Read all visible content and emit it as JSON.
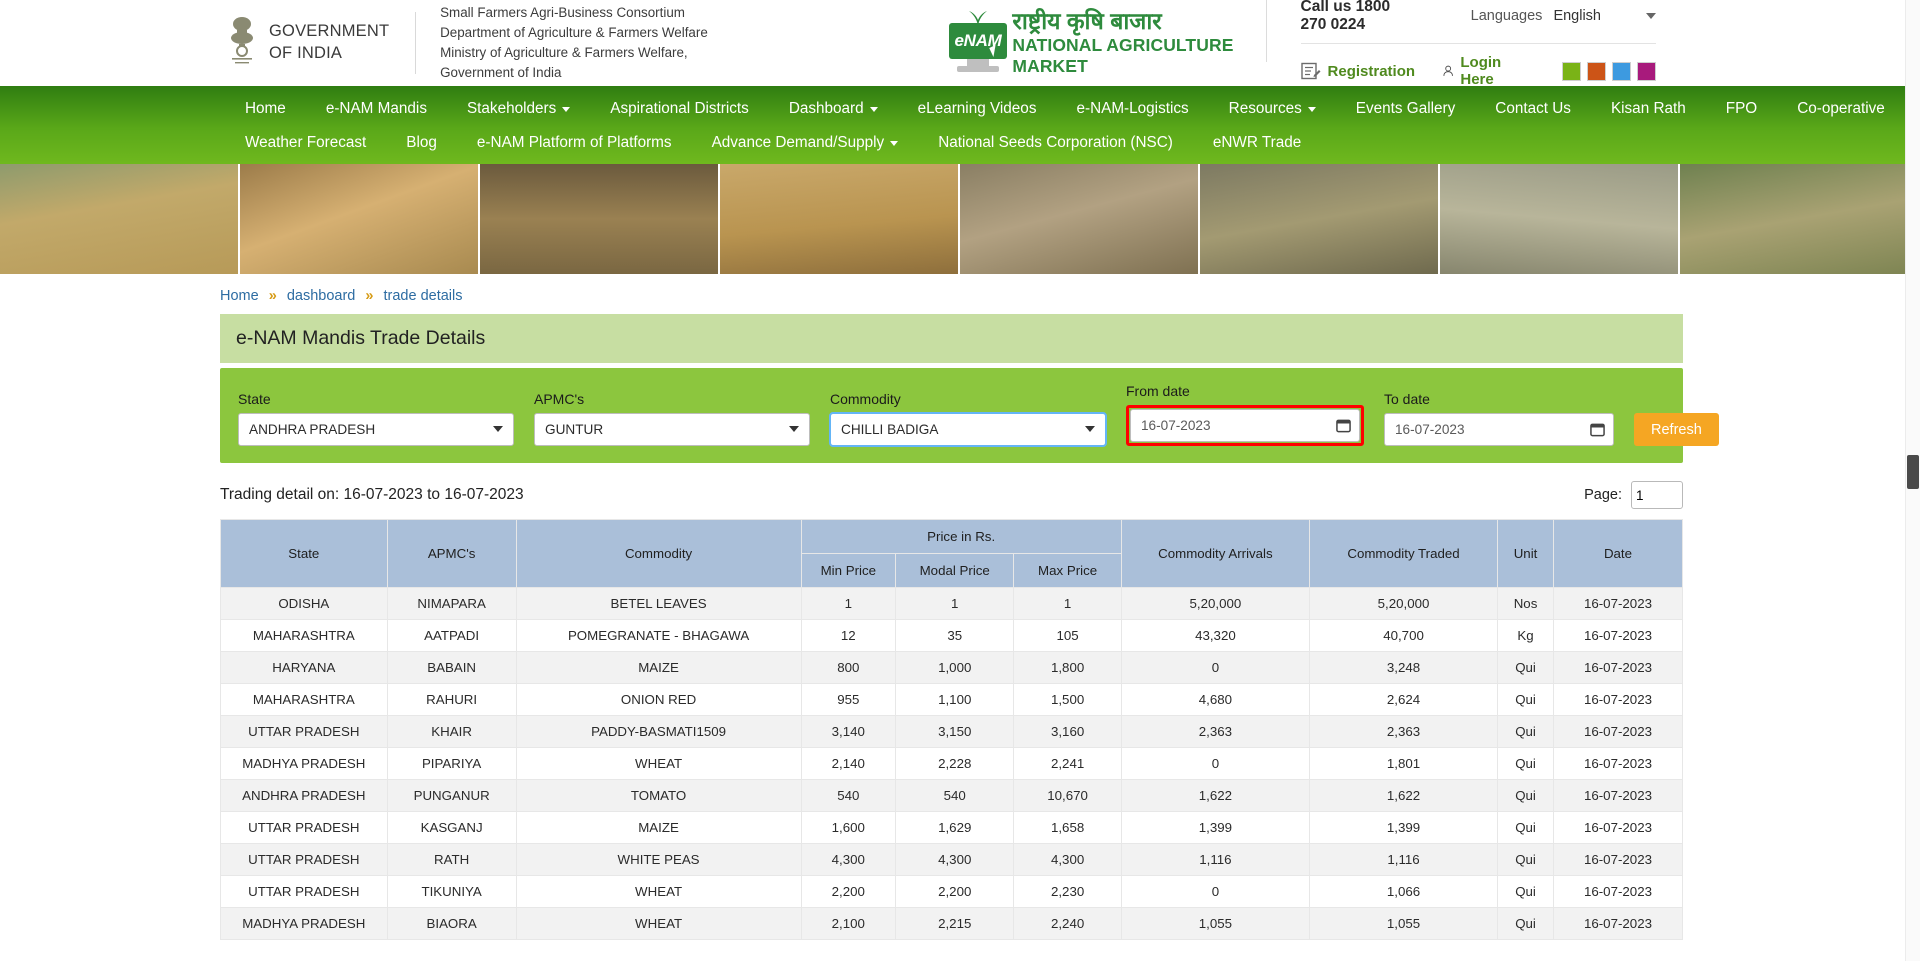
{
  "header": {
    "emblem_icon": "india-emblem-icon",
    "goi_line1": "GOVERNMENT",
    "goi_line2": "OF INDIA",
    "sfac_line1": "Small Farmers Agri-Business Consortium",
    "sfac_line2": "Department of Agriculture & Farmers Welfare",
    "sfac_line3": "Ministry of Agriculture & Farmers Welfare, Government of India",
    "logo_mark": "eNAM",
    "logo_hindi": "राष्ट्रीय कृषि बाजार",
    "logo_english": "NATIONAL AGRICULTURE MARKET",
    "call_us": "Call us 1800 270 0224",
    "languages_label": "Languages",
    "language_value": "English",
    "registration": "Registration",
    "login": "Login Here",
    "swatches": [
      "#7ab317",
      "#cc5417",
      "#3d9ae0",
      "#a81a7c"
    ]
  },
  "nav": {
    "row1": [
      {
        "label": "Home",
        "caret": false
      },
      {
        "label": "e-NAM Mandis",
        "caret": false
      },
      {
        "label": "Stakeholders",
        "caret": true
      },
      {
        "label": "Aspirational Districts",
        "caret": false
      },
      {
        "label": "Dashboard",
        "caret": true
      },
      {
        "label": "eLearning Videos",
        "caret": false
      },
      {
        "label": "e-NAM-Logistics",
        "caret": false
      },
      {
        "label": "Resources",
        "caret": true
      },
      {
        "label": "Events Gallery",
        "caret": false
      },
      {
        "label": "Contact Us",
        "caret": false
      },
      {
        "label": "Kisan Rath",
        "caret": false
      },
      {
        "label": "FPO",
        "caret": false
      },
      {
        "label": "Co-operative",
        "caret": false
      }
    ],
    "row2": [
      {
        "label": "Weather Forecast",
        "caret": false
      },
      {
        "label": "Blog",
        "caret": false
      },
      {
        "label": "e-NAM Platform of Platforms",
        "caret": false
      },
      {
        "label": "Advance Demand/Supply",
        "caret": true
      },
      {
        "label": "National Seeds Corporation (NSC)",
        "caret": false
      },
      {
        "label": "eNWR Trade",
        "caret": false
      }
    ]
  },
  "breadcrumb": {
    "home": "Home",
    "dashboard": "dashboard",
    "current": "trade details",
    "separator": "»"
  },
  "panel": {
    "title": "e-NAM Mandis Trade Details"
  },
  "filters": {
    "state_label": "State",
    "state_value": "ANDHRA PRADESH",
    "apmc_label": "APMC's",
    "apmc_value": "GUNTUR",
    "commodity_label": "Commodity",
    "commodity_value": "CHILLI BADIGA",
    "from_label": "From date",
    "from_value": "16-07-2023",
    "to_label": "To date",
    "to_value": "16-07-2023",
    "refresh_label": "Refresh"
  },
  "results": {
    "trading_detail": "Trading detail on: 16-07-2023 to 16-07-2023",
    "page_label": "Page:",
    "page_value": "1"
  },
  "table": {
    "headers": {
      "state": "State",
      "apmc": "APMC's",
      "commodity": "Commodity",
      "price_group": "Price in Rs.",
      "min_price": "Min Price",
      "modal_price": "Modal Price",
      "max_price": "Max Price",
      "arrivals": "Commodity Arrivals",
      "traded": "Commodity Traded",
      "unit": "Unit",
      "date": "Date"
    },
    "rows": [
      {
        "state": "ODISHA",
        "apmc": "NIMAPARA",
        "commodity": "BETEL LEAVES",
        "min": "1",
        "modal": "1",
        "max": "1",
        "arrivals": "5,20,000",
        "traded": "5,20,000",
        "unit": "Nos",
        "date": "16-07-2023"
      },
      {
        "state": "MAHARASHTRA",
        "apmc": "AATPADI",
        "commodity": "POMEGRANATE - BHAGAWA",
        "min": "12",
        "modal": "35",
        "max": "105",
        "arrivals": "43,320",
        "traded": "40,700",
        "unit": "Kg",
        "date": "16-07-2023"
      },
      {
        "state": "HARYANA",
        "apmc": "BABAIN",
        "commodity": "MAIZE",
        "min": "800",
        "modal": "1,000",
        "max": "1,800",
        "arrivals": "0",
        "traded": "3,248",
        "unit": "Qui",
        "date": "16-07-2023"
      },
      {
        "state": "MAHARASHTRA",
        "apmc": "RAHURI",
        "commodity": "ONION RED",
        "min": "955",
        "modal": "1,100",
        "max": "1,500",
        "arrivals": "4,680",
        "traded": "2,624",
        "unit": "Qui",
        "date": "16-07-2023"
      },
      {
        "state": "UTTAR PRADESH",
        "apmc": "KHAIR",
        "commodity": "PADDY-BASMATI1509",
        "min": "3,140",
        "modal": "3,150",
        "max": "3,160",
        "arrivals": "2,363",
        "traded": "2,363",
        "unit": "Qui",
        "date": "16-07-2023"
      },
      {
        "state": "MADHYA PRADESH",
        "apmc": "PIPARIYA",
        "commodity": "WHEAT",
        "min": "2,140",
        "modal": "2,228",
        "max": "2,241",
        "arrivals": "0",
        "traded": "1,801",
        "unit": "Qui",
        "date": "16-07-2023"
      },
      {
        "state": "ANDHRA PRADESH",
        "apmc": "PUNGANUR",
        "commodity": "TOMATO",
        "min": "540",
        "modal": "540",
        "max": "10,670",
        "arrivals": "1,622",
        "traded": "1,622",
        "unit": "Qui",
        "date": "16-07-2023"
      },
      {
        "state": "UTTAR PRADESH",
        "apmc": "KASGANJ",
        "commodity": "MAIZE",
        "min": "1,600",
        "modal": "1,629",
        "max": "1,658",
        "arrivals": "1,399",
        "traded": "1,399",
        "unit": "Qui",
        "date": "16-07-2023"
      },
      {
        "state": "UTTAR PRADESH",
        "apmc": "RATH",
        "commodity": "WHITE PEAS",
        "min": "4,300",
        "modal": "4,300",
        "max": "4,300",
        "arrivals": "1,116",
        "traded": "1,116",
        "unit": "Qui",
        "date": "16-07-2023"
      },
      {
        "state": "UTTAR PRADESH",
        "apmc": "TIKUNIYA",
        "commodity": "WHEAT",
        "min": "2,200",
        "modal": "2,200",
        "max": "2,230",
        "arrivals": "0",
        "traded": "1,066",
        "unit": "Qui",
        "date": "16-07-2023"
      },
      {
        "state": "MADHYA PRADESH",
        "apmc": "BIAORA",
        "commodity": "WHEAT",
        "min": "2,100",
        "modal": "2,215",
        "max": "2,240",
        "arrivals": "1,055",
        "traded": "1,055",
        "unit": "Qui",
        "date": "16-07-2023"
      }
    ]
  },
  "colors": {
    "nav_green": "#5aa819",
    "panel_title_bg": "#c7dea2",
    "filter_bg": "#8cc63e",
    "refresh_orange": "#f5a623",
    "table_header_blue": "#aabfd9",
    "highlight_red": "#ff0000",
    "brand_green": "#2e8b3d"
  }
}
